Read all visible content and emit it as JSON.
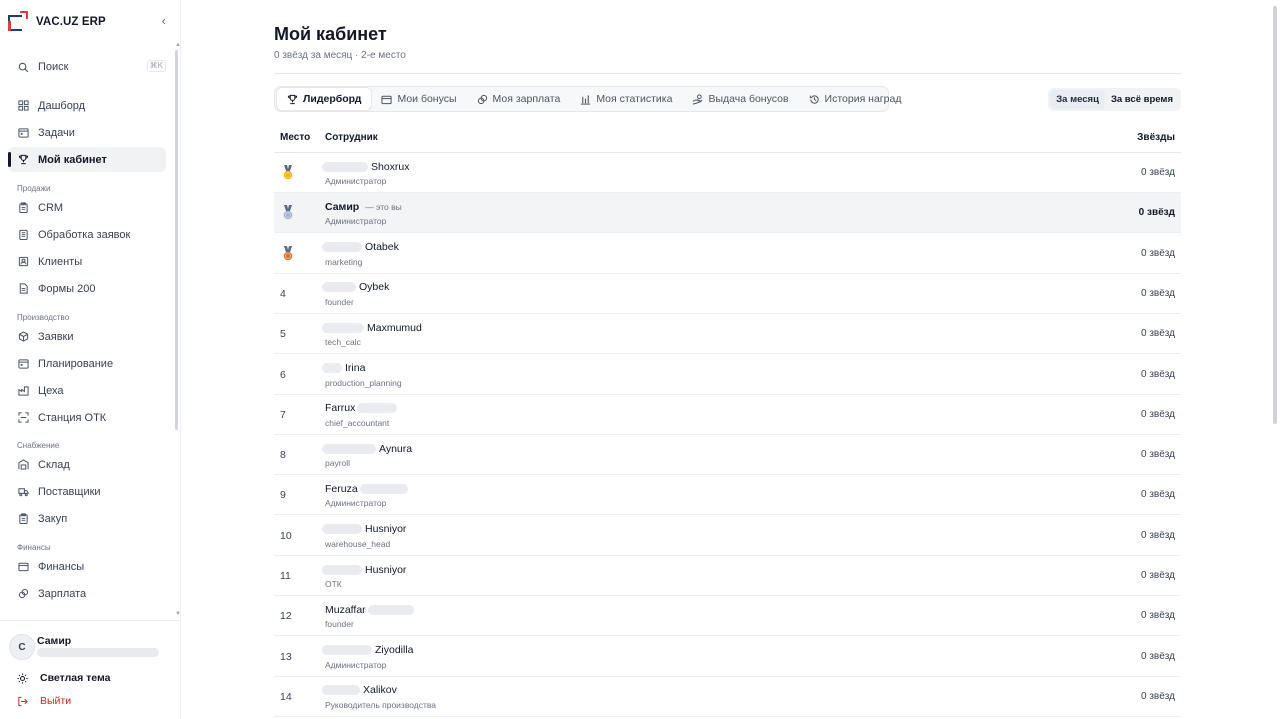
{
  "app": {
    "name": "VAC.UZ ERP",
    "collapse_icon": "chevron-left-icon"
  },
  "sidebar": {
    "search": {
      "label": "Поиск",
      "shortcut": "⌘K"
    },
    "items_top": [
      {
        "label": "Дашборд",
        "icon": "grid-icon"
      },
      {
        "label": "Задачи",
        "icon": "calendar-icon"
      },
      {
        "label": "Мой кабинет",
        "icon": "trophy-icon",
        "active": true
      }
    ],
    "sections": [
      {
        "title": "Продажи",
        "items": [
          {
            "label": "CRM",
            "icon": "clipboard-icon"
          },
          {
            "label": "Обработка заявок",
            "icon": "clipboard-list-icon"
          },
          {
            "label": "Клиенты",
            "icon": "contacts-icon"
          },
          {
            "label": "Формы 200",
            "icon": "file-icon"
          }
        ]
      },
      {
        "title": "Производство",
        "items": [
          {
            "label": "Заявки",
            "icon": "boxes-icon"
          },
          {
            "label": "Планирование",
            "icon": "calendar-icon"
          },
          {
            "label": "Цеха",
            "icon": "factory-icon"
          },
          {
            "label": "Станция ОТК",
            "icon": "scan-icon"
          }
        ]
      },
      {
        "title": "Снабжение",
        "items": [
          {
            "label": "Склад",
            "icon": "warehouse-icon"
          },
          {
            "label": "Поставщики",
            "icon": "truck-icon"
          },
          {
            "label": "Закуп",
            "icon": "clipboard-icon"
          }
        ]
      },
      {
        "title": "Финансы",
        "items": [
          {
            "label": "Финансы",
            "icon": "wallet-icon"
          },
          {
            "label": "Зарплата",
            "icon": "coins-icon"
          }
        ]
      }
    ],
    "user": {
      "initial": "С",
      "name": "Самир"
    },
    "theme_label": "Светлая тема",
    "logout_label": "Выйти"
  },
  "main": {
    "title": "Мой кабинет",
    "subtitle": "0 звёзд за месяц · 2-е место",
    "tabs": [
      {
        "label": "Лидерборд",
        "icon": "trophy-icon",
        "active": true
      },
      {
        "label": "Мои бонусы",
        "icon": "wallet-icon"
      },
      {
        "label": "Моя зарплата",
        "icon": "coins-icon"
      },
      {
        "label": "Моя статистика",
        "icon": "bar-chart-icon"
      },
      {
        "label": "Выдача бонусов",
        "icon": "hand-coins-icon"
      },
      {
        "label": "История наград",
        "icon": "history-icon"
      }
    ],
    "period": {
      "month": "За месяц",
      "all": "За всё время"
    },
    "table": {
      "col_place": "Место",
      "col_employee": "Сотрудник",
      "col_stars": "Звёзды",
      "you_tag": "— это вы",
      "rows": [
        {
          "place": "1",
          "medal": "gold",
          "name": "Shoxrux",
          "role": "Администратор",
          "stars": "0 звёзд"
        },
        {
          "place": "2",
          "medal": "silver",
          "name": "Самир",
          "role": "Администратор",
          "stars": "0 звёзд",
          "me": true
        },
        {
          "place": "3",
          "medal": "bronze",
          "name": "Otabek",
          "role": "marketing",
          "stars": "0 звёзд"
        },
        {
          "place": "4",
          "name": "Oybek",
          "role": "founder",
          "stars": "0 звёзд"
        },
        {
          "place": "5",
          "name": "Maxmumud",
          "role": "tech_calc",
          "stars": "0 звёзд"
        },
        {
          "place": "6",
          "name": "Irina",
          "role": "production_planning",
          "stars": "0 звёзд"
        },
        {
          "place": "7",
          "name": "Farrux",
          "role": "chief_accountant",
          "stars": "0 звёзд"
        },
        {
          "place": "8",
          "name": "Aynura",
          "role": "payroll",
          "stars": "0 звёзд"
        },
        {
          "place": "9",
          "name": "Feruza",
          "role": "Администратор",
          "stars": "0 звёзд"
        },
        {
          "place": "10",
          "name": "Husniyor",
          "role": "warehouse_head",
          "stars": "0 звёзд"
        },
        {
          "place": "11",
          "name": "Husniyor",
          "role": "ОТК",
          "stars": "0 звёзд"
        },
        {
          "place": "12",
          "name": "Muzaffar",
          "role": "founder",
          "stars": "0 звёзд"
        },
        {
          "place": "13",
          "name": "Ziyodilla",
          "role": "Администратор",
          "stars": "0 звёзд"
        },
        {
          "place": "14",
          "name": "Xalikov",
          "role": "Руководитель производства",
          "stars": "0 звёзд"
        }
      ]
    }
  },
  "colors": {
    "accent_red": "#e53935",
    "brand_blue": "#1f3b73",
    "gold": "#f5b301",
    "silver": "#a5b4cf",
    "bronze": "#d9773b"
  }
}
